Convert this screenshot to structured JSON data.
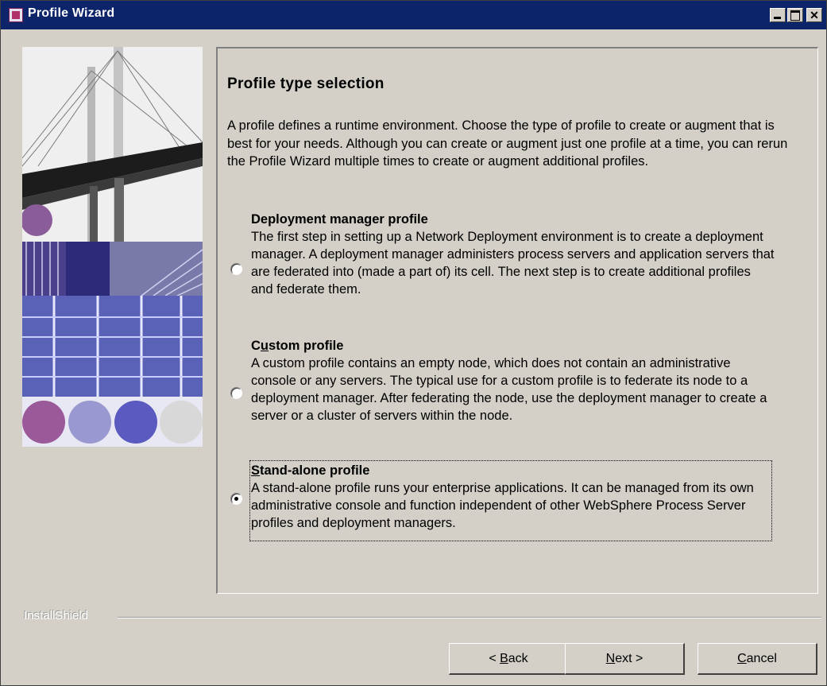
{
  "window": {
    "title": "Profile Wizard"
  },
  "page": {
    "heading": "Profile type selection",
    "intro": "A profile defines a runtime environment. Choose the type of profile to create or augment that is best for your needs. Although you can create or augment just one profile at a time, you can rerun the Profile Wizard multiple times to create or augment additional profiles."
  },
  "options": [
    {
      "title": "Deployment manager profile",
      "description": "The first step in setting up a Network Deployment environment is to create a deployment manager. A deployment manager administers process servers and application servers that are federated into (made a part of) its cell. The next step is to create additional profiles and federate them.",
      "selected": false
    },
    {
      "title_prefix": "C",
      "title_mnemonic": "u",
      "title_rest": "stom profile",
      "description": "A custom profile contains an empty node, which does not contain an administrative console or any servers. The typical use for a custom profile is to federate its node to a deployment manager. After federating the node, use the deployment manager to create a server or a cluster of servers within the node.",
      "selected": false
    },
    {
      "title_mnemonic": "S",
      "title_rest": "tand-alone profile",
      "description": "A stand-alone profile runs your enterprise applications. It can be managed from its own administrative console and function independent of other WebSphere Process Server profiles and deployment managers.",
      "selected": true
    }
  ],
  "footer": {
    "brand": "InstallShield"
  },
  "buttons": {
    "back": {
      "prefix": "< ",
      "mnemonic": "B",
      "rest": "ack"
    },
    "next": {
      "mnemonic": "N",
      "rest": "ext >"
    },
    "cancel": {
      "mnemonic": "C",
      "rest": "ancel"
    }
  },
  "colors": {
    "titlebar": "#0b246a",
    "dialog_bg": "#d4d0c8"
  }
}
